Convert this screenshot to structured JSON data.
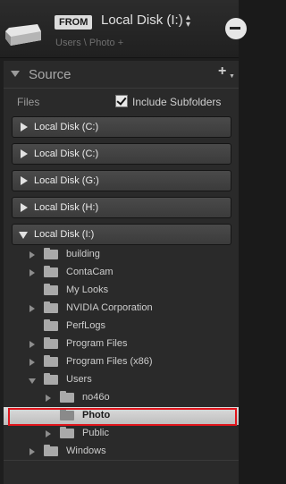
{
  "header": {
    "badge": "FROM",
    "title": "Local Disk (I:)",
    "caret": "⌃⌄",
    "path": "Users \\ Photo +"
  },
  "panel": {
    "title": "Source",
    "add": "+"
  },
  "files": {
    "label": "Files",
    "include_subfolders": "Include Subfolders",
    "include_subfolders_checked": true
  },
  "volumes": [
    {
      "label": "Local Disk (C:)",
      "expanded": false
    },
    {
      "label": "Local Disk (C:)",
      "expanded": false
    },
    {
      "label": "Local Disk (G:)",
      "expanded": false
    },
    {
      "label": "Local Disk (H:)",
      "expanded": false
    },
    {
      "label": "Local Disk (I:)",
      "expanded": true
    }
  ],
  "folders": [
    {
      "label": "building",
      "depth": 0,
      "arrow": "right"
    },
    {
      "label": "ContaCam",
      "depth": 0,
      "arrow": "right"
    },
    {
      "label": "My Looks",
      "depth": 0,
      "arrow": "none"
    },
    {
      "label": "NVIDIA Corporation",
      "depth": 0,
      "arrow": "right"
    },
    {
      "label": "PerfLogs",
      "depth": 0,
      "arrow": "none"
    },
    {
      "label": "Program Files",
      "depth": 0,
      "arrow": "right"
    },
    {
      "label": "Program Files (x86)",
      "depth": 0,
      "arrow": "right"
    },
    {
      "label": "Users",
      "depth": 0,
      "arrow": "down"
    },
    {
      "label": "no46o",
      "depth": 1,
      "arrow": "right"
    },
    {
      "label": "Photo",
      "depth": 1,
      "arrow": "none",
      "selected": true
    },
    {
      "label": "Public",
      "depth": 1,
      "arrow": "right"
    },
    {
      "label": "Windows",
      "depth": 0,
      "arrow": "right"
    }
  ],
  "colors": {
    "selection_outline": "#e0141b",
    "panel_bg": "#2a2a2a"
  }
}
